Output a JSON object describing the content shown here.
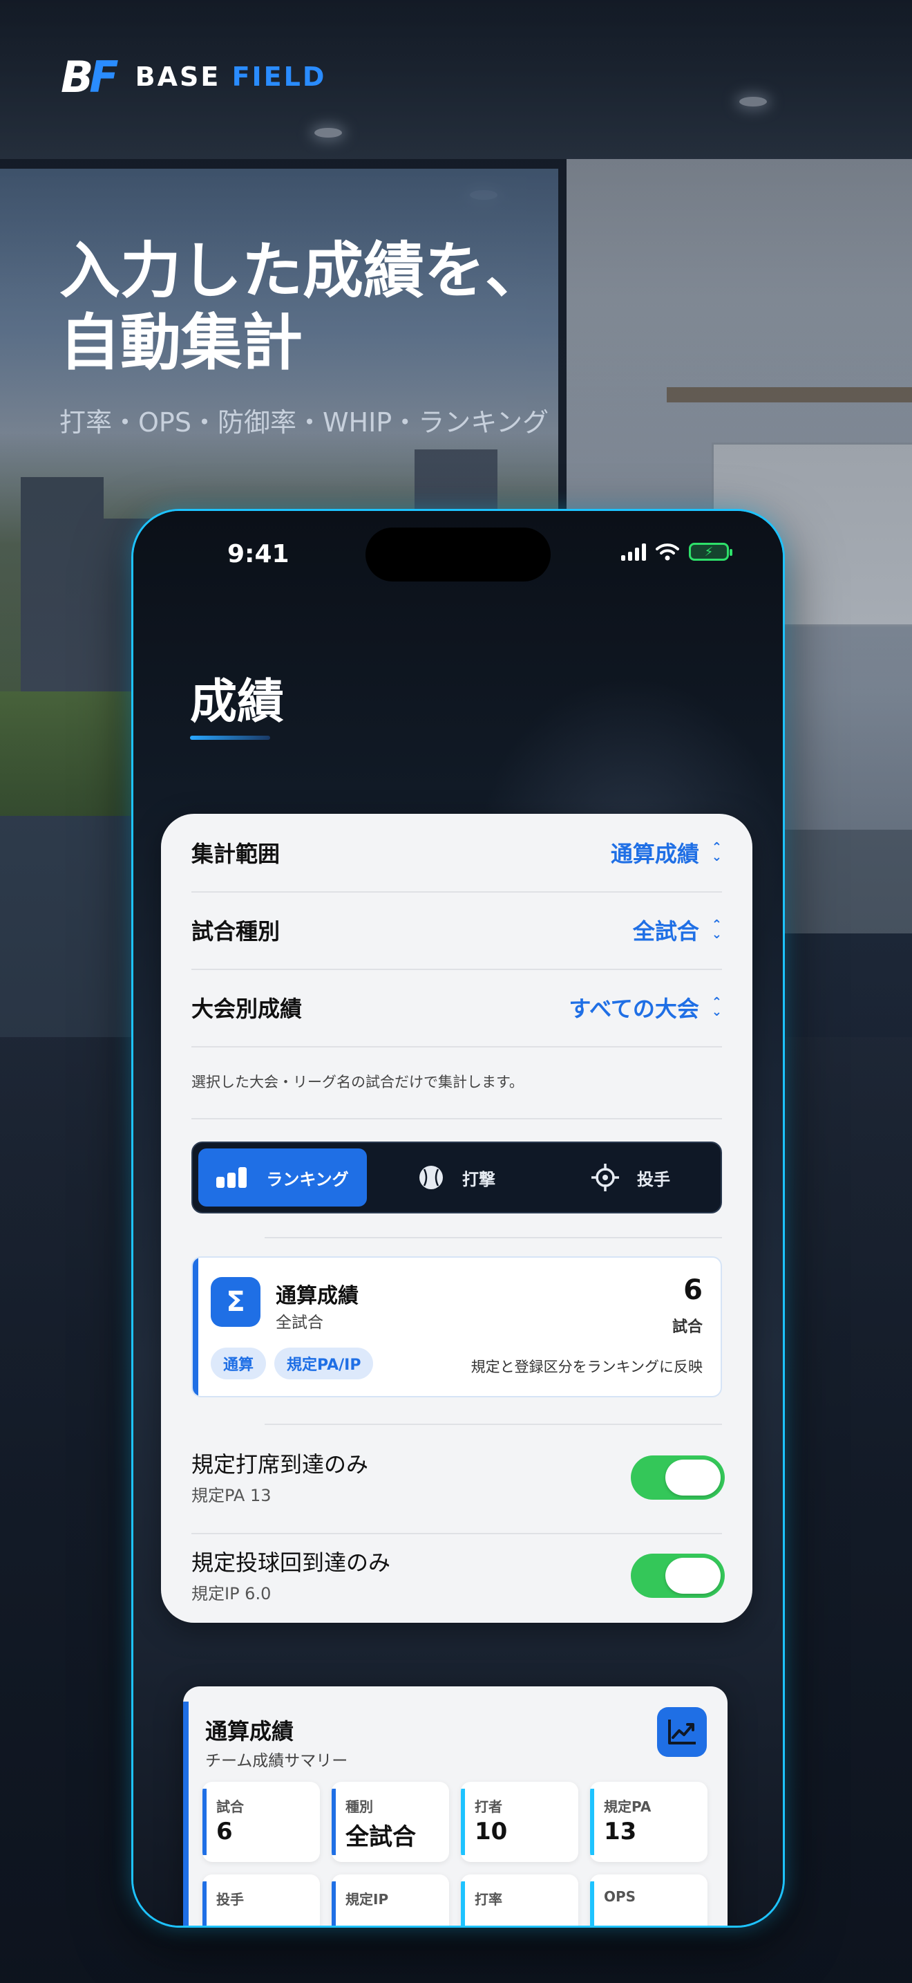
{
  "brand": {
    "mark": "BF",
    "name_part1": "BASE",
    "name_part2": "FIELD",
    "accent": "#2a8cff"
  },
  "hero": {
    "headline_line1": "入力した成績を、",
    "headline_line2": "自動集計",
    "subline": "打率・OPS・防御率・WHIP・ランキング"
  },
  "status_bar": {
    "time": "9:41",
    "battery_icon": "battery-charging-icon",
    "wifi_icon": "wifi-icon",
    "signal_icon": "signal-icon"
  },
  "page": {
    "title": "成績"
  },
  "filters": [
    {
      "label": "集計範囲",
      "value": "通算成績"
    },
    {
      "label": "試合種別",
      "value": "全試合"
    },
    {
      "label": "大会別成績",
      "value": "すべての大会"
    }
  ],
  "filter_note": "選択した大会・リーグ名の試合だけで集計します。",
  "segments": [
    {
      "label": "ランキング",
      "icon": "bar-chart-icon",
      "active": true
    },
    {
      "label": "打撃",
      "icon": "baseball-icon",
      "active": false
    },
    {
      "label": "投手",
      "icon": "target-icon",
      "active": false
    }
  ],
  "summary": {
    "icon_symbol": "Σ",
    "title": "通算成績",
    "subtitle": "全試合",
    "count": "6",
    "count_unit": "試合",
    "chips": [
      "通算",
      "規定PA/IP"
    ],
    "note": "規定と登録区分をランキングに反映"
  },
  "toggles": [
    {
      "label": "規定打席到達のみ",
      "sub": "規定PA 13",
      "on": true
    },
    {
      "label": "規定投球回到達のみ",
      "sub": "規定IP 6.0",
      "on": true
    }
  ],
  "team_summary": {
    "title": "通算成績",
    "subtitle": "チーム成績サマリー",
    "icon": "trend-chart-icon",
    "stats": [
      {
        "label": "試合",
        "value": "6"
      },
      {
        "label": "種別",
        "value": "全試合"
      },
      {
        "label": "打者",
        "value": "10"
      },
      {
        "label": "規定PA",
        "value": "13"
      },
      {
        "label": "投手",
        "value": ""
      },
      {
        "label": "規定IP",
        "value": ""
      },
      {
        "label": "打率",
        "value": ""
      },
      {
        "label": "OPS",
        "value": ""
      }
    ]
  },
  "colors": {
    "accent_blue": "#1f6fe5",
    "toggle_green": "#34c759",
    "phone_border": "#1ec3ff"
  }
}
